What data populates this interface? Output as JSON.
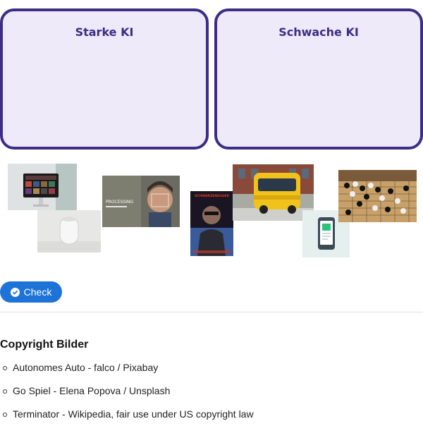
{
  "zones": {
    "strong_label": "Starke KI",
    "weak_label": "Schwache KI"
  },
  "cards": {
    "face_recognition_text": "PROCESSING",
    "terminator_poster_text": "SCHWARZENEGGER"
  },
  "check_button": {
    "label": "Check",
    "icon": "check-circle-icon"
  },
  "copyright": {
    "title": "Copyright Bilder",
    "items": [
      "Autonomes Auto - falco / Pixabay",
      "Go Spiel - Elena Popova / Unsplash",
      "Terminator - Wikipedia, fair use under US copyright law"
    ]
  },
  "colors": {
    "zone_border": "#3c2d86",
    "zone_fill": "#eeeaf9",
    "button": "#1e73d8"
  }
}
